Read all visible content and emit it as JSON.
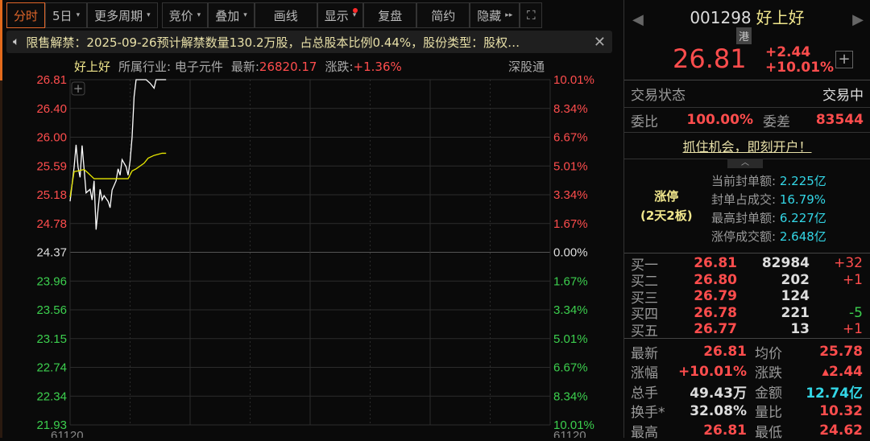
{
  "toolbar": {
    "items": [
      {
        "label": "分时",
        "caret": ""
      },
      {
        "label": "5日",
        "caret": "▾"
      },
      {
        "label": "更多周期",
        "caret": "▾"
      },
      {
        "label": "竞价",
        "caret": "▾"
      },
      {
        "label": "叠加",
        "caret": "▾"
      },
      {
        "label": "画线",
        "caret": ""
      },
      {
        "label": "显示",
        "caret": "▾"
      },
      {
        "label": "复盘",
        "caret": ""
      },
      {
        "label": "简约",
        "caret": ""
      },
      {
        "label": "隐藏",
        "caret": "▸▸"
      }
    ],
    "fullscreen": "⛶"
  },
  "notice": {
    "text": "限售解禁：2025-09-26预计解禁数量130.2万股，占总股本比例0.44%，股份类型：股权…",
    "close": "✕"
  },
  "info": {
    "name": "好上好",
    "industry": "所属行业: 电子元件",
    "latest": "最新:",
    "latest_val": "26820.17",
    "chg": "涨跌:",
    "chg_val": "+1.36%",
    "connect": "深股通"
  },
  "chart_data": {
    "type": "line",
    "ylim": [
      21.93,
      26.81
    ],
    "prev_close": 24.37,
    "minutes": 241,
    "left_ticks": [
      "26.81",
      "26.40",
      "26.00",
      "25.59",
      "25.18",
      "24.78",
      "24.37",
      "23.96",
      "23.56",
      "23.15",
      "22.74",
      "22.34",
      "21.93"
    ],
    "right_ticks": [
      "10.01%",
      "8.34%",
      "6.67%",
      "5.01%",
      "3.34%",
      "1.67%",
      "0.00%",
      "1.67%",
      "3.34%",
      "5.01%",
      "6.67%",
      "8.34%",
      "10.01%"
    ],
    "volume_label": "61120",
    "series": [
      {
        "name": "price",
        "color": "#ffffff",
        "points": [
          [
            0,
            25.09
          ],
          [
            2,
            25.57
          ],
          [
            3,
            25.89
          ],
          [
            4,
            25.57
          ],
          [
            5,
            25.43
          ],
          [
            6,
            25.88
          ],
          [
            7,
            25.55
          ],
          [
            8,
            25.21
          ],
          [
            10,
            25.26
          ],
          [
            11,
            25.11
          ],
          [
            12,
            25.38
          ],
          [
            13,
            24.69
          ],
          [
            14,
            24.98
          ],
          [
            15,
            25.26
          ],
          [
            16,
            25.11
          ],
          [
            17,
            25.17
          ],
          [
            19,
            25.09
          ],
          [
            20,
            25.0
          ],
          [
            21,
            25.25
          ],
          [
            23,
            25.38
          ],
          [
            24,
            25.55
          ],
          [
            25,
            25.46
          ],
          [
            26,
            25.68
          ],
          [
            28,
            25.58
          ],
          [
            29,
            25.46
          ],
          [
            30,
            25.66
          ],
          [
            31,
            26.0
          ],
          [
            32,
            26.57
          ],
          [
            33,
            26.81
          ],
          [
            38,
            26.81
          ],
          [
            40,
            26.76
          ],
          [
            42,
            26.69
          ],
          [
            43,
            26.81
          ],
          [
            48,
            26.81
          ]
        ]
      },
      {
        "name": "average",
        "color": "#e6e600",
        "points": [
          [
            0,
            25.15
          ],
          [
            2,
            25.51
          ],
          [
            4,
            25.52
          ],
          [
            7,
            25.54
          ],
          [
            9,
            25.49
          ],
          [
            12,
            25.41
          ],
          [
            15,
            25.41
          ],
          [
            21,
            25.41
          ],
          [
            29,
            25.41
          ],
          [
            31,
            25.52
          ],
          [
            33,
            25.55
          ],
          [
            37,
            25.63
          ],
          [
            39,
            25.7
          ],
          [
            42,
            25.74
          ],
          [
            46,
            25.77
          ],
          [
            48,
            25.77
          ]
        ]
      }
    ]
  },
  "quote": {
    "code": "001298",
    "name": "好上好",
    "tag": "港",
    "price": "26.81",
    "change": "+2.44",
    "pct": "+10.01%",
    "plus": "+"
  },
  "status": {
    "label": "交易状态",
    "value": "交易中"
  },
  "weibi": {
    "label": "委比",
    "value": "100.00%",
    "label2": "委差",
    "value2": "83544"
  },
  "promo": "抓住机会，即刻开户！",
  "limit": {
    "title": "涨停",
    "sub": "(2天2板)",
    "rows": [
      {
        "k": "当前封单额:",
        "v": "2.225亿"
      },
      {
        "k": "封单占成交:",
        "v": "16.79%"
      },
      {
        "k": "最高封单额:",
        "v": "6.227亿"
      },
      {
        "k": "涨停成交额:",
        "v": "2.648亿"
      }
    ]
  },
  "orderbook": [
    {
      "n": "买一",
      "p": "26.81",
      "v": "82984",
      "d": "+32",
      "dc": "red"
    },
    {
      "n": "买二",
      "p": "26.80",
      "v": "202",
      "d": "+1",
      "dc": "red"
    },
    {
      "n": "买三",
      "p": "26.79",
      "v": "124",
      "d": "",
      "dc": "red"
    },
    {
      "n": "买四",
      "p": "26.78",
      "v": "221",
      "d": "-5",
      "dc": "green"
    },
    {
      "n": "买五",
      "p": "26.77",
      "v": "13",
      "d": "+1",
      "dc": "red"
    }
  ],
  "stats": [
    {
      "k": "最新",
      "v": "26.81",
      "vc": "red",
      "k2": "均价",
      "v2": "25.78",
      "v2c": "red"
    },
    {
      "k": "涨幅",
      "v": "+10.01%",
      "vc": "red",
      "k2": "涨跌",
      "v2": "▴2.44",
      "v2c": "red"
    },
    {
      "k": "总手",
      "v": "49.43万",
      "vc": "wht",
      "k2": "金额",
      "v2": "12.74亿",
      "v2c": "cyan"
    },
    {
      "k": "换手*",
      "v": "32.08%",
      "vc": "wht",
      "k2": "量比",
      "v2": "10.32",
      "v2c": "red"
    },
    {
      "k": "最高",
      "v": "26.81",
      "vc": "red",
      "k2": "最低",
      "v2": "24.62",
      "v2c": "red"
    }
  ]
}
